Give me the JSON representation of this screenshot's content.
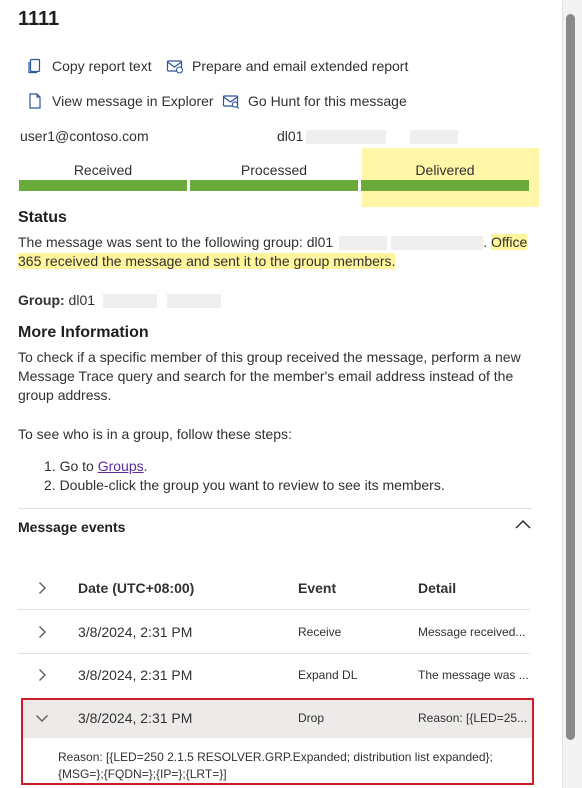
{
  "title": "1111",
  "actions": {
    "copy_report": "Copy report text",
    "prepare_email": "Prepare and email extended report",
    "view_explorer": "View message in Explorer",
    "go_hunt": "Go Hunt for this message"
  },
  "sender": "user1@contoso.com",
  "recipient_prefix": "dl01",
  "progress": {
    "steps": [
      "Received",
      "Processed",
      "Delivered"
    ],
    "current_step": "Delivered"
  },
  "status": {
    "heading": "Status",
    "text_before": "The message was sent to the following group: dl01",
    "text_highlight": "Office 365 received the message and sent it to the group members."
  },
  "group": {
    "label": "Group:",
    "value_prefix": "dl01"
  },
  "more_info": {
    "heading": "More Information",
    "paragraph1": "To check if a specific member of this group received the message, perform a new Message Trace query and search for the member's email address instead of the group address.",
    "paragraph2": "To see who is in a group, follow these steps:",
    "step1_prefix": "1. Go to ",
    "step1_link": "Groups",
    "step1_suffix": ".",
    "step2": "2. Double-click the group you want to review to see its members."
  },
  "message_events": {
    "heading": "Message events",
    "columns": {
      "date": "Date (UTC+08:00)",
      "event": "Event",
      "detail": "Detail"
    },
    "rows": [
      {
        "date": "3/8/2024, 2:31 PM",
        "event": "Receive",
        "detail": "Message received..."
      },
      {
        "date": "3/8/2024, 2:31 PM",
        "event": "Expand DL",
        "detail": "The message was ..."
      },
      {
        "date": "3/8/2024, 2:31 PM",
        "event": "Drop",
        "detail": "Reason: [{LED=25..."
      }
    ],
    "expanded_detail": "Reason: [{LED=250 2.1.5 RESOLVER.GRP.Expanded; distribution list expanded};{MSG=};{FQDN=};{IP=};{LRT=}]"
  },
  "colors": {
    "progress": "#6aaa3b",
    "highlight": "#fff59d",
    "selection_border": "#d01c28",
    "link": "#5a2ca0"
  }
}
